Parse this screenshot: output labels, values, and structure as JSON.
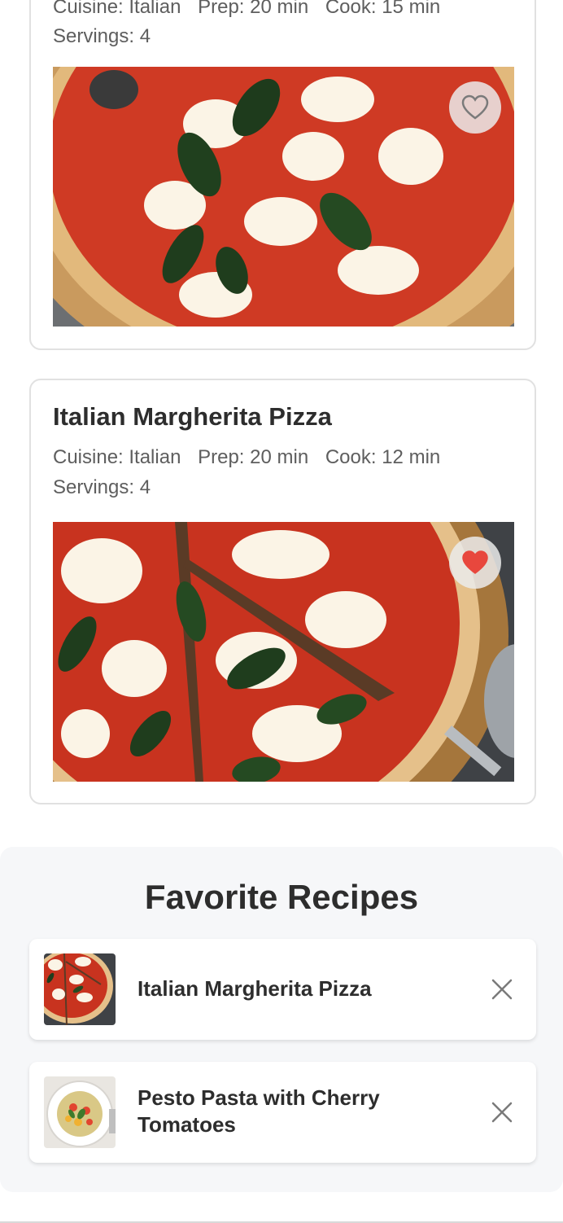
{
  "recipes": [
    {
      "meta_line1": [
        "Cuisine: Italian",
        "Prep: 20 min",
        "Cook: 15 min"
      ],
      "meta_line2": "Servings: 4",
      "favorited": false
    },
    {
      "title": "Italian Margherita Pizza",
      "meta_line1": [
        "Cuisine: Italian",
        "Prep: 20 min",
        "Cook: 12 min"
      ],
      "meta_line2": "Servings: 4",
      "favorited": true
    }
  ],
  "favorites": {
    "title": "Favorite Recipes",
    "items": [
      {
        "name": "Italian Margherita Pizza",
        "thumb_icon": "pizza-thumbnail"
      },
      {
        "name": "Pesto Pasta with Cherry Tomatoes",
        "thumb_icon": "pasta-thumbnail"
      }
    ]
  },
  "colors": {
    "heart_active": "#e8473d",
    "heart_inactive": "#7a7a7a",
    "panel_bg": "#f6f7f9",
    "card_border": "#e1e1e1"
  },
  "icons": {
    "favorite": "heart-icon",
    "remove": "close-icon"
  }
}
